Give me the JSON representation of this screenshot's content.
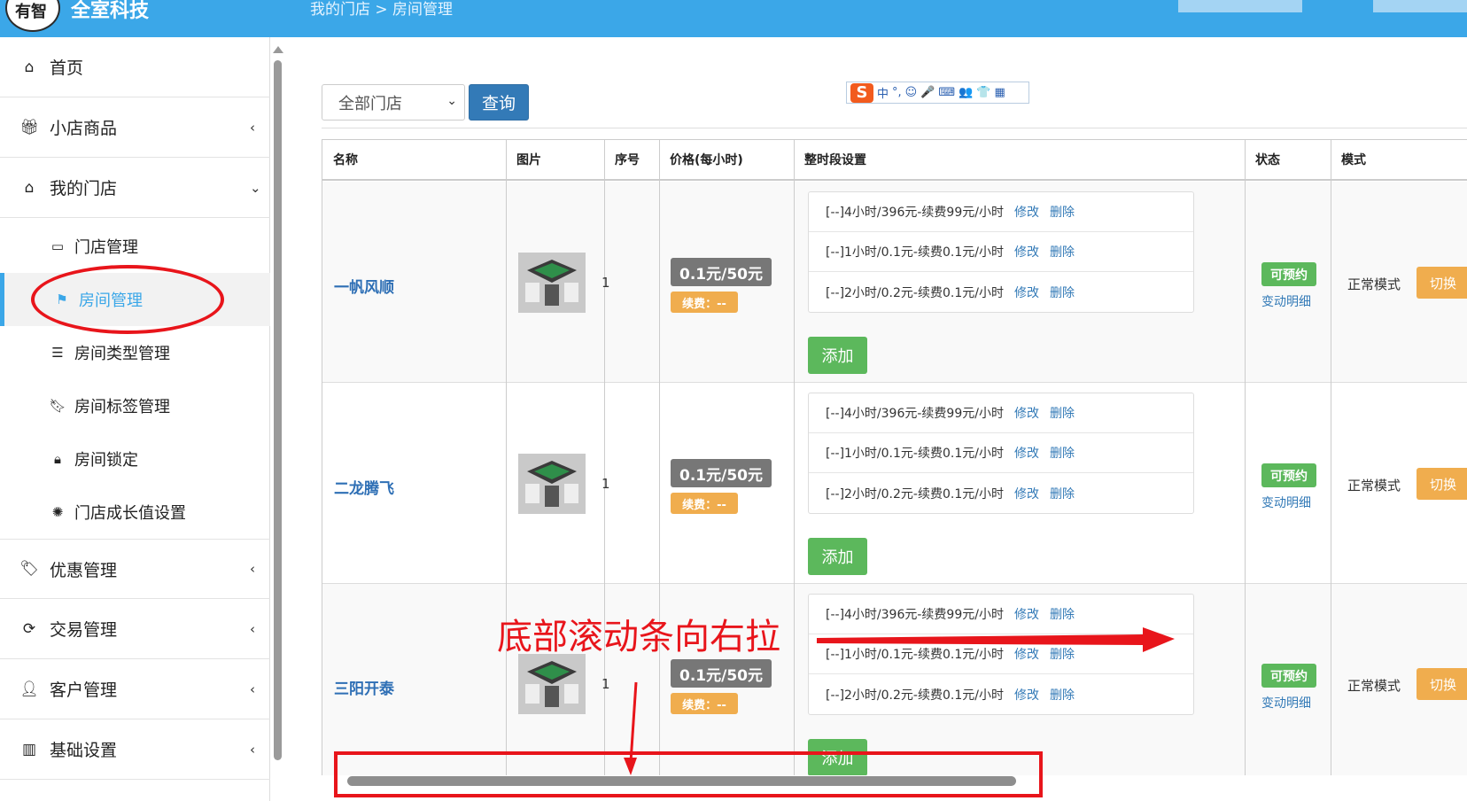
{
  "header": {
    "logo_text": "有智",
    "brand": "全室科技",
    "breadcrumb": "我的门店  >  房间管理"
  },
  "sidebar": {
    "items": [
      {
        "label": "首页",
        "icon": "home-icon"
      },
      {
        "label": "小店商品",
        "icon": "gift-icon"
      },
      {
        "label": "我的门店",
        "icon": "home-icon"
      },
      {
        "label": "优惠管理",
        "icon": "tags-icon"
      },
      {
        "label": "交易管理",
        "icon": "refresh-icon"
      },
      {
        "label": "客户管理",
        "icon": "user-icon"
      },
      {
        "label": "基础设置",
        "icon": "barcode-icon"
      }
    ],
    "subitems": [
      {
        "label": "门店管理",
        "icon": "inbox-icon"
      },
      {
        "label": "房间管理",
        "icon": "flag-icon",
        "active": true
      },
      {
        "label": "房间类型管理",
        "icon": "list-icon"
      },
      {
        "label": "房间标签管理",
        "icon": "bookmark-icon"
      },
      {
        "label": "房间锁定",
        "icon": "lock-icon"
      },
      {
        "label": "门店成长值设置",
        "icon": "gear-icon"
      }
    ]
  },
  "filter": {
    "store_select": "全部门店",
    "query_label": "查询"
  },
  "ime": {
    "logo": "S",
    "items": [
      "中",
      "°,",
      "☺",
      "🎤",
      "⌨",
      "👥",
      "👕",
      "▦"
    ]
  },
  "table": {
    "headers": [
      "名称",
      "图片",
      "序号",
      "价格(每小时)",
      "整时段设置",
      "状态",
      "模式"
    ],
    "rows": [
      {
        "name": "一帆风顺",
        "seq": "1",
        "price": "0.1元/50元",
        "fee": "续费：--",
        "slots": [
          "[--]4小时/396元-续费99元/小时",
          "[--]1小时/0.1元-续费0.1元/小时",
          "[--]2小时/0.2元-续费0.1元/小时"
        ],
        "status": "可预约",
        "status_link": "变动明细",
        "mode": "正常模式",
        "switch": "切换"
      },
      {
        "name": "二龙腾飞",
        "seq": "1",
        "price": "0.1元/50元",
        "fee": "续费：--",
        "slots": [
          "[--]4小时/396元-续费99元/小时",
          "[--]1小时/0.1元-续费0.1元/小时",
          "[--]2小时/0.2元-续费0.1元/小时"
        ],
        "status": "可预约",
        "status_link": "变动明细",
        "mode": "正常模式",
        "switch": "切换"
      },
      {
        "name": "三阳开泰",
        "seq": "1",
        "price": "0.1元/50元",
        "fee": "续费：--",
        "slots": [
          "[--]4小时/396元-续费99元/小时",
          "[--]1小时/0.1元-续费0.1元/小时",
          "[--]2小时/0.2元-续费0.1元/小时"
        ],
        "status": "可预约",
        "status_link": "变动明细",
        "mode": "正常模式",
        "switch": "切换"
      }
    ],
    "slot_edit": "修改",
    "slot_delete": "删除",
    "add_label": "添加"
  },
  "annotation": {
    "text": "底部滚动条向右拉",
    "color": "#e8151b"
  }
}
